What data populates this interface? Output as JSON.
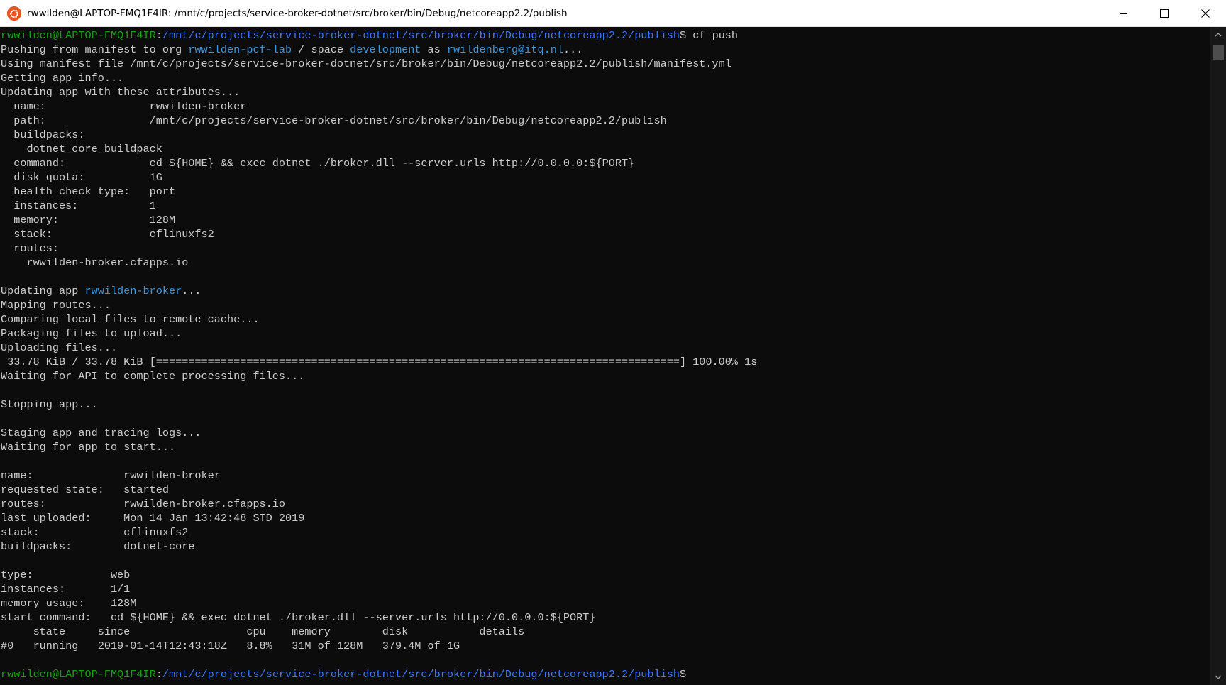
{
  "window": {
    "title": "rwwilden@LAPTOP-FMQ1F4IR: /mnt/c/projects/service-broker-dotnet/src/broker/bin/Debug/netcoreapp2.2/publish",
    "icon": "ubuntu-icon",
    "controls": [
      "minimize-icon",
      "maximize-icon",
      "close-icon"
    ]
  },
  "colors": {
    "background": "#0c0c0c",
    "text": "#cccccc",
    "prompt_user": "#13a10e",
    "prompt_path": "#3b78ff",
    "highlight": "#3a96dd"
  },
  "prompt": {
    "user": "rwwilden@LAPTOP-FMQ1F4IR",
    "colon": ":",
    "path": "/mnt/c/projects/service-broker-dotnet/src/broker/bin/Debug/netcoreapp2.2/publish",
    "symbol": "$",
    "command": " cf push"
  },
  "push_info": {
    "l1_prefix": "Pushing from manifest to org ",
    "org": "rwwilden-pcf-lab",
    "l1_mid1": " / space ",
    "space": "development",
    "l1_mid2": " as ",
    "user": "rwildenberg@itq.nl",
    "l1_suffix": "...",
    "manifest_line": "Using manifest file /mnt/c/projects/service-broker-dotnet/src/broker/bin/Debug/netcoreapp2.2/publish/manifest.yml",
    "getting_info": "Getting app info...",
    "updating_attrs": "Updating app with these attributes..."
  },
  "attributes": [
    "  name:                rwwilden-broker",
    "  path:                /mnt/c/projects/service-broker-dotnet/src/broker/bin/Debug/netcoreapp2.2/publish",
    "  buildpacks:",
    "    dotnet_core_buildpack",
    "  command:             cd ${HOME} && exec dotnet ./broker.dll --server.urls http://0.0.0.0:${PORT}",
    "  disk quota:          1G",
    "  health check type:   port",
    "  instances:           1",
    "  memory:              128M",
    "  stack:               cflinuxfs2",
    "  routes:",
    "    rwwilden-broker.cfapps.io"
  ],
  "updating": {
    "prefix": "Updating app ",
    "app": "rwwilden-broker",
    "suffix": "..."
  },
  "progress_lines": [
    "Mapping routes...",
    "Comparing local files to remote cache...",
    "Packaging files to upload...",
    "Uploading files..."
  ],
  "upload_bar": " 33.78 KiB / 33.78 KiB [=================================================================================] 100.00% 1s",
  "upload_progress_percent": 100,
  "waiting_api": "Waiting for API to complete processing files...",
  "stopping": "Stopping app...",
  "staging": "Staging app and tracing logs...",
  "waiting_start": "Waiting for app to start...",
  "status": [
    "name:              rwwilden-broker",
    "requested state:   started",
    "routes:            rwwilden-broker.cfapps.io",
    "last uploaded:     Mon 14 Jan 13:42:48 STD 2019",
    "stack:             cflinuxfs2",
    "buildpacks:        dotnet-core"
  ],
  "process": [
    "type:            web",
    "instances:       1/1",
    "memory usage:    128M",
    "start command:   cd ${HOME} && exec dotnet ./broker.dll --server.urls http://0.0.0.0:${PORT}"
  ],
  "instance_table": {
    "header": "     state     since                  cpu    memory        disk           details",
    "row": "#0   running   2019-01-14T12:43:18Z   8.8%   31M of 128M   379.4M of 1G"
  }
}
